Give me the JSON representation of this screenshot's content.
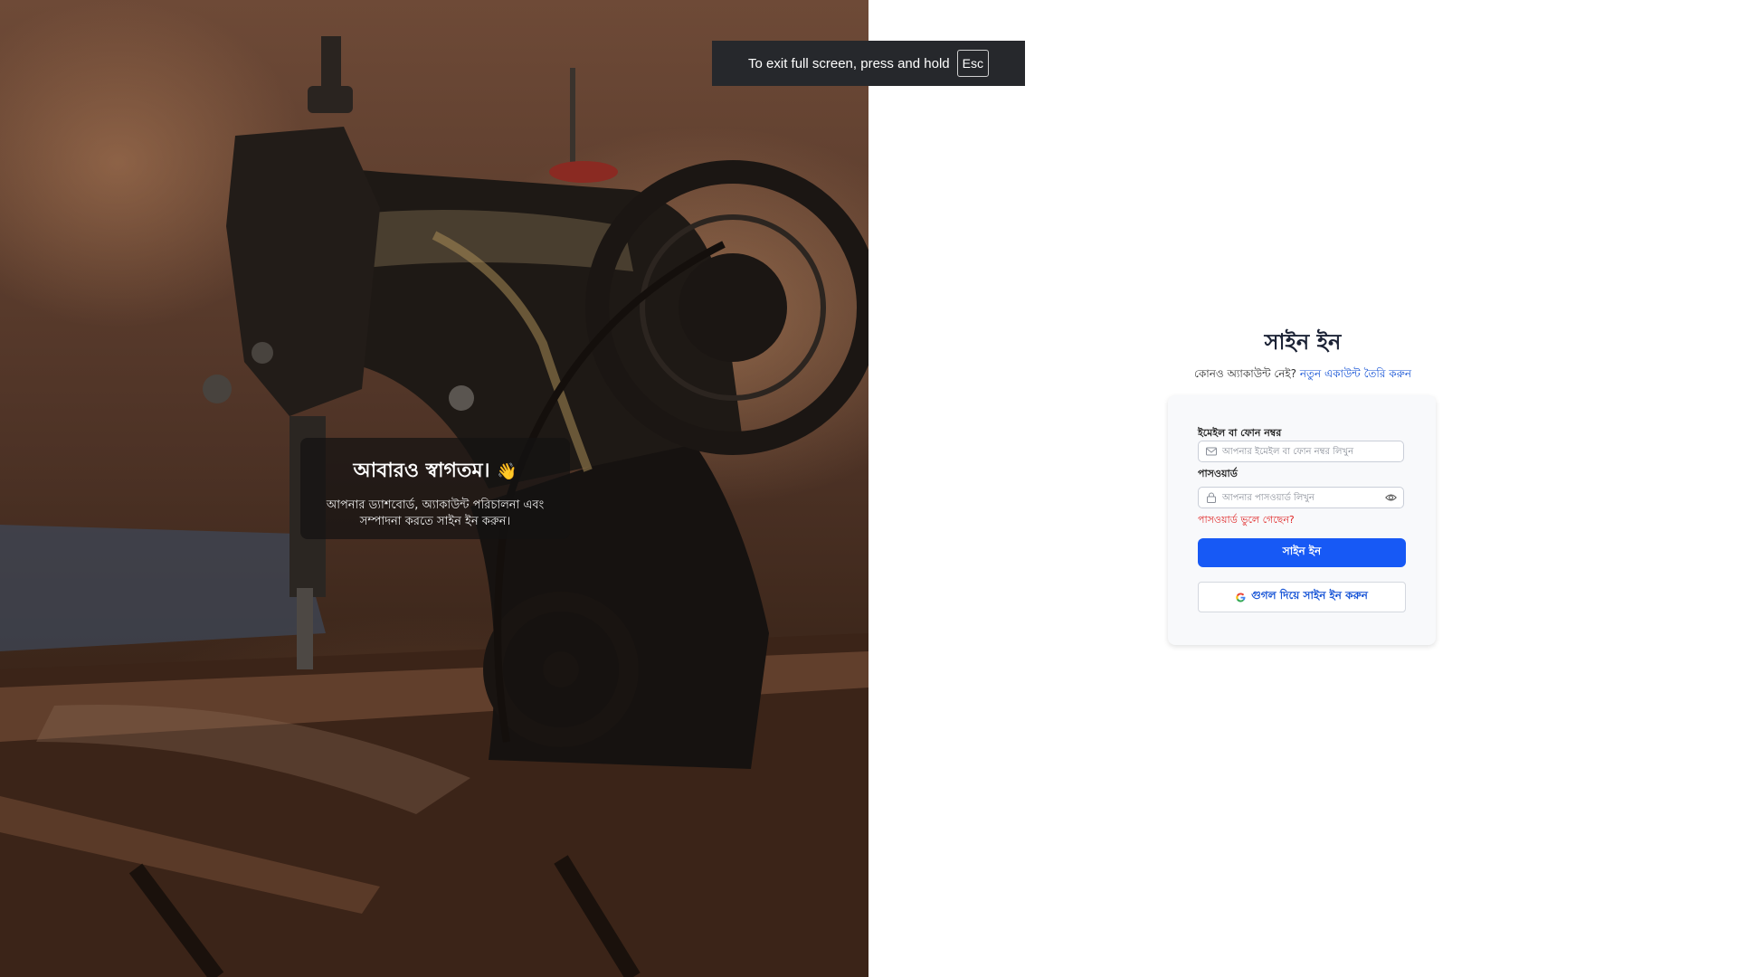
{
  "hero": {
    "welcome_title": "আবারও স্বাগতম।",
    "welcome_emoji": "👋",
    "welcome_subtitle": "আপনার ড্যাশবোর্ড, অ্যাকাউন্ট পরিচালনা এবং সম্পাদনা করতে সাইন ইন করুন।"
  },
  "fullscreen_toast": {
    "message": "To exit full screen, press and hold",
    "key": "Esc"
  },
  "signin": {
    "title": "সাইন ইন",
    "no_account_text": "কোনও অ্যাকাউন্ট নেই?",
    "create_account_link": "নতুন একাউন্ট তৈরি করুন",
    "email_label": "ইমেইল বা ফোন নম্বর",
    "email_placeholder": "আপনার ইমেইল বা ফোন নম্বর লিখুন",
    "email_value": "",
    "password_label": "পাসওয়ার্ড",
    "password_placeholder": "আপনার পাসওয়ার্ড লিখুন",
    "password_value": "",
    "forgot_password": "পাসওয়ার্ড ভুলে গেছেন?",
    "submit_label": "সাইন ইন",
    "google_label": "গুগল দিয়ে সাইন ইন করুন"
  },
  "colors": {
    "primary": "#1759f5",
    "link": "#1553d6",
    "error": "#e02424",
    "title": "#1c2336"
  },
  "icons": [
    "envelope-icon",
    "lock-icon",
    "eye-icon",
    "google-icon",
    "waving-hand-icon"
  ]
}
